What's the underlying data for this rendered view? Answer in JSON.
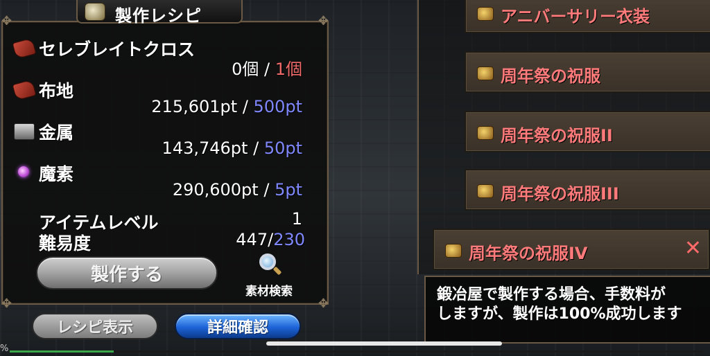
{
  "panel": {
    "title": "製作レシピ",
    "title_icon": "anvil-crafting-icon"
  },
  "materials": [
    {
      "name": "セレブレイトクロス",
      "have": "0個",
      "sep": "/",
      "need": "1個",
      "icon": "cloth-icon",
      "need_color": "#f06a6a"
    },
    {
      "name": "布地",
      "have": "215,601pt",
      "sep": "/",
      "need": "500pt",
      "icon": "cloth-icon",
      "need_color": "#7f88ff"
    },
    {
      "name": "金属",
      "have": "143,746pt",
      "sep": "/",
      "need": "50pt",
      "icon": "metal-chest-icon",
      "need_color": "#7f88ff"
    },
    {
      "name": "魔素",
      "have": "290,600pt",
      "sep": "/",
      "need": "5pt",
      "icon": "mana-orb-icon",
      "need_color": "#7f88ff"
    }
  ],
  "item_level": {
    "label": "アイテムレベル",
    "value": "1"
  },
  "difficulty": {
    "label": "難易度",
    "value": "447/",
    "value_blue": "230"
  },
  "buttons": {
    "craft": "製作する",
    "search": "素材検索",
    "show_recipe": "レシピ表示",
    "detail": "詳細確認"
  },
  "list": [
    {
      "label": "アニバーサリー衣装",
      "selected": false
    },
    {
      "label": "周年祭の祝服",
      "selected": false
    },
    {
      "label": "周年祭の祝服II",
      "selected": false
    },
    {
      "label": "周年祭の祝服III",
      "selected": false
    },
    {
      "label": "周年祭の祝服IV",
      "selected": true
    }
  ],
  "close_glyph": "✕",
  "description": {
    "line1": "鍛冶屋で製作する場合、手数料が",
    "line2": "しますが、製作は100%成功します"
  },
  "progress": {
    "label": "%",
    "fraction": 0.15
  },
  "colors": {
    "item_text": "#ff7a7a",
    "required_ok": "#7f88ff",
    "required_missing": "#f06a6a",
    "detail_button": "#1d63d8"
  }
}
